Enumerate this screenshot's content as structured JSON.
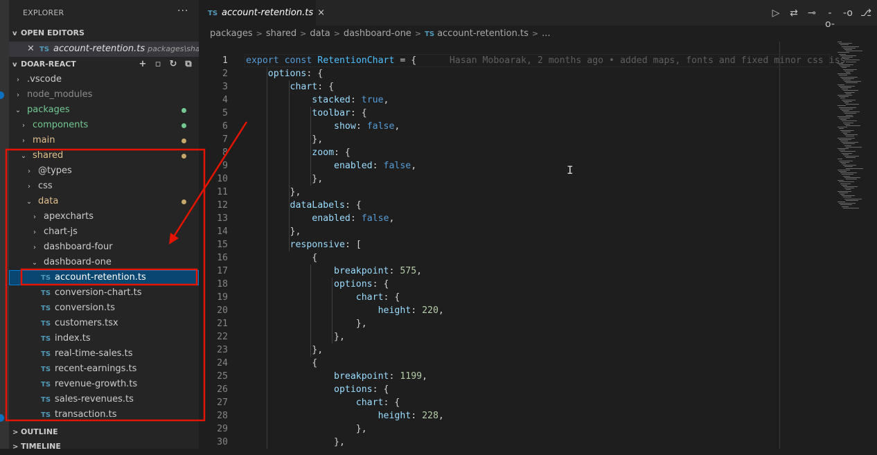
{
  "explorer": {
    "title": "EXPLORER",
    "more": "···",
    "open_editors": {
      "header": "OPEN EDITORS",
      "file": "account-retention.ts",
      "path": "packages\\share...",
      "badge": "TS"
    },
    "workspace": {
      "header": "DOAR-REACT"
    },
    "tree": [
      {
        "label": ".vscode",
        "color": "#cccccc",
        "twisty": ">"
      },
      {
        "label": "node_modules",
        "color": "#8c8c8c",
        "twisty": ">"
      },
      {
        "label": "packages",
        "color": "#73c991",
        "twisty": "v",
        "dot": "#73c991"
      },
      {
        "label": "components",
        "color": "#73c991",
        "twisty": ">",
        "dot": "#73c991"
      },
      {
        "label": "main",
        "color": "#e2c08d",
        "twisty": ">",
        "dot": "#c5a86a"
      },
      {
        "label": "shared",
        "color": "#e2c08d",
        "twisty": "v",
        "dot": "#c5a86a"
      },
      {
        "label": "@types",
        "color": "#cccccc",
        "twisty": ">"
      },
      {
        "label": "css",
        "color": "#cccccc",
        "twisty": ">"
      },
      {
        "label": "data",
        "color": "#e2c08d",
        "twisty": "v",
        "dot": "#c5a86a"
      },
      {
        "label": "apexcharts",
        "color": "#cccccc",
        "twisty": ">"
      },
      {
        "label": "chart-js",
        "color": "#cccccc",
        "twisty": ">"
      },
      {
        "label": "dashboard-four",
        "color": "#cccccc",
        "twisty": ">"
      },
      {
        "label": "dashboard-one",
        "color": "#cccccc",
        "twisty": "v"
      },
      {
        "label": "account-retention.ts",
        "color": "#ffffff",
        "badge": "TS",
        "selected": true
      },
      {
        "label": "conversion-chart.ts",
        "color": "#cccccc",
        "badge": "TS"
      },
      {
        "label": "conversion.ts",
        "color": "#cccccc",
        "badge": "TS"
      },
      {
        "label": "customers.tsx",
        "color": "#cccccc",
        "badge": "TS"
      },
      {
        "label": "index.ts",
        "color": "#cccccc",
        "badge": "TS"
      },
      {
        "label": "real-time-sales.ts",
        "color": "#cccccc",
        "badge": "TS"
      },
      {
        "label": "recent-earnings.ts",
        "color": "#cccccc",
        "badge": "TS"
      },
      {
        "label": "revenue-growth.ts",
        "color": "#cccccc",
        "badge": "TS"
      },
      {
        "label": "sales-revenues.ts",
        "color": "#cccccc",
        "badge": "TS"
      },
      {
        "label": "transaction.ts",
        "color": "#cccccc",
        "badge": "TS"
      }
    ],
    "outline": "OUTLINE",
    "timeline": "TIMELINE"
  },
  "tab": {
    "badge": "TS",
    "label": "account-retention.ts",
    "close": "×"
  },
  "breadcrumb": [
    "packages",
    "shared",
    "data",
    "dashboard-one",
    "TS",
    "account-retention.ts",
    "..."
  ],
  "blame": "Hasan Moboarak, 2 months ago • added maps, fonts and fixed minor css iss",
  "code": [
    {
      "n": "1",
      "html": "<span class='k'>export</span> <span class='k'>const</span> <span class='v'>RetentionChart</span><span class='d'> = {</span>"
    },
    {
      "n": "2",
      "html": "    <span class='p'>options</span><span class='d'>: {</span>"
    },
    {
      "n": "3",
      "html": "        <span class='p'>chart</span><span class='d'>: {</span>"
    },
    {
      "n": "4",
      "html": "            <span class='p'>stacked</span><span class='d'>: </span><span class='k'>true</span><span class='d'>,</span>"
    },
    {
      "n": "5",
      "html": "            <span class='p'>toolbar</span><span class='d'>: {</span>"
    },
    {
      "n": "6",
      "html": "                <span class='p'>show</span><span class='d'>: </span><span class='k'>false</span><span class='d'>,</span>"
    },
    {
      "n": "7",
      "html": "            <span class='d'>},</span>"
    },
    {
      "n": "8",
      "html": "            <span class='p'>zoom</span><span class='d'>: {</span>"
    },
    {
      "n": "9",
      "html": "                <span class='p'>enabled</span><span class='d'>: </span><span class='k'>false</span><span class='d'>,</span>"
    },
    {
      "n": "10",
      "html": "            <span class='d'>},</span>"
    },
    {
      "n": "11",
      "html": "        <span class='d'>},</span>"
    },
    {
      "n": "12",
      "html": "        <span class='p'>dataLabels</span><span class='d'>: {</span>"
    },
    {
      "n": "13",
      "html": "            <span class='p'>enabled</span><span class='d'>: </span><span class='k'>false</span><span class='d'>,</span>"
    },
    {
      "n": "14",
      "html": "        <span class='d'>},</span>"
    },
    {
      "n": "15",
      "html": "        <span class='p'>responsive</span><span class='d'>: [</span>"
    },
    {
      "n": "16",
      "html": "            <span class='d'>{</span>"
    },
    {
      "n": "17",
      "html": "                <span class='p'>breakpoint</span><span class='d'>: </span><span class='n'>575</span><span class='d'>,</span>"
    },
    {
      "n": "18",
      "html": "                <span class='p'>options</span><span class='d'>: {</span>"
    },
    {
      "n": "19",
      "html": "                    <span class='p'>chart</span><span class='d'>: {</span>"
    },
    {
      "n": "20",
      "html": "                        <span class='p'>height</span><span class='d'>: </span><span class='n'>220</span><span class='d'>,</span>"
    },
    {
      "n": "21",
      "html": "                    <span class='d'>},</span>"
    },
    {
      "n": "22",
      "html": "                <span class='d'>},</span>"
    },
    {
      "n": "23",
      "html": "            <span class='d'>},</span>"
    },
    {
      "n": "24",
      "html": "            <span class='d'>{</span>"
    },
    {
      "n": "25",
      "html": "                <span class='p'>breakpoint</span><span class='d'>: </span><span class='n'>1199</span><span class='d'>,</span>"
    },
    {
      "n": "26",
      "html": "                <span class='p'>options</span><span class='d'>: {</span>"
    },
    {
      "n": "27",
      "html": "                    <span class='p'>chart</span><span class='d'>: {</span>"
    },
    {
      "n": "28",
      "html": "                        <span class='p'>height</span><span class='d'>: </span><span class='n'>228</span><span class='d'>,</span>"
    },
    {
      "n": "29",
      "html": "                    <span class='d'>},</span>"
    },
    {
      "n": "30",
      "html": "                <span class='d'>},</span>"
    }
  ],
  "colors": {
    "highlight": "#e51400",
    "selection": "#094771",
    "accent": "#007fd4"
  }
}
